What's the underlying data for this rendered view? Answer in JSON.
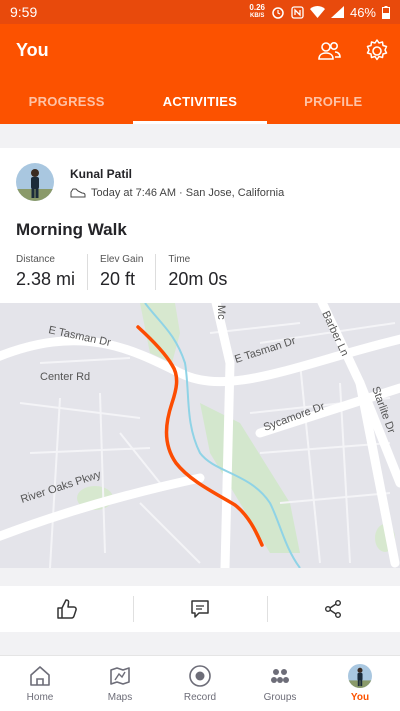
{
  "status_bar": {
    "time": "9:59",
    "net_speed_value": "0.26",
    "net_speed_unit": "KB/S",
    "battery": "46%"
  },
  "app_bar": {
    "title": "You",
    "tabs": [
      {
        "label": "PROGRESS",
        "active": false
      },
      {
        "label": "ACTIVITIES",
        "active": true
      },
      {
        "label": "PROFILE",
        "active": false
      }
    ],
    "icons": [
      "people-icon",
      "settings-icon"
    ]
  },
  "activity": {
    "athlete": "Kunal Patil",
    "meta": "Today at 7:46 AM · San Jose, California",
    "title": "Morning Walk",
    "stats": [
      {
        "label": "Distance",
        "value": "2.38 mi"
      },
      {
        "label": "Elev Gain",
        "value": "20 ft"
      },
      {
        "label": "Time",
        "value": "20m 0s"
      }
    ],
    "map": {
      "streets": [
        "E Tasman Dr",
        "E Tasman Dr",
        "Center Rd",
        "Sycamore Dr",
        "River Oaks Pkwy",
        "Barber Ln",
        "Starlite Dr",
        "Mc"
      ],
      "route_color": "#fc4c02"
    }
  },
  "actions": [
    "like-icon",
    "comment-icon",
    "share-icon"
  ],
  "bottom_nav": [
    {
      "label": "Home",
      "icon": "home-icon",
      "active": false
    },
    {
      "label": "Maps",
      "icon": "map-icon",
      "active": false
    },
    {
      "label": "Record",
      "icon": "record-icon",
      "active": false
    },
    {
      "label": "Groups",
      "icon": "groups-icon",
      "active": false
    },
    {
      "label": "You",
      "icon": "avatar",
      "active": true
    }
  ],
  "colors": {
    "brand": "#fc5200",
    "status_bar": "#e84a0c"
  }
}
